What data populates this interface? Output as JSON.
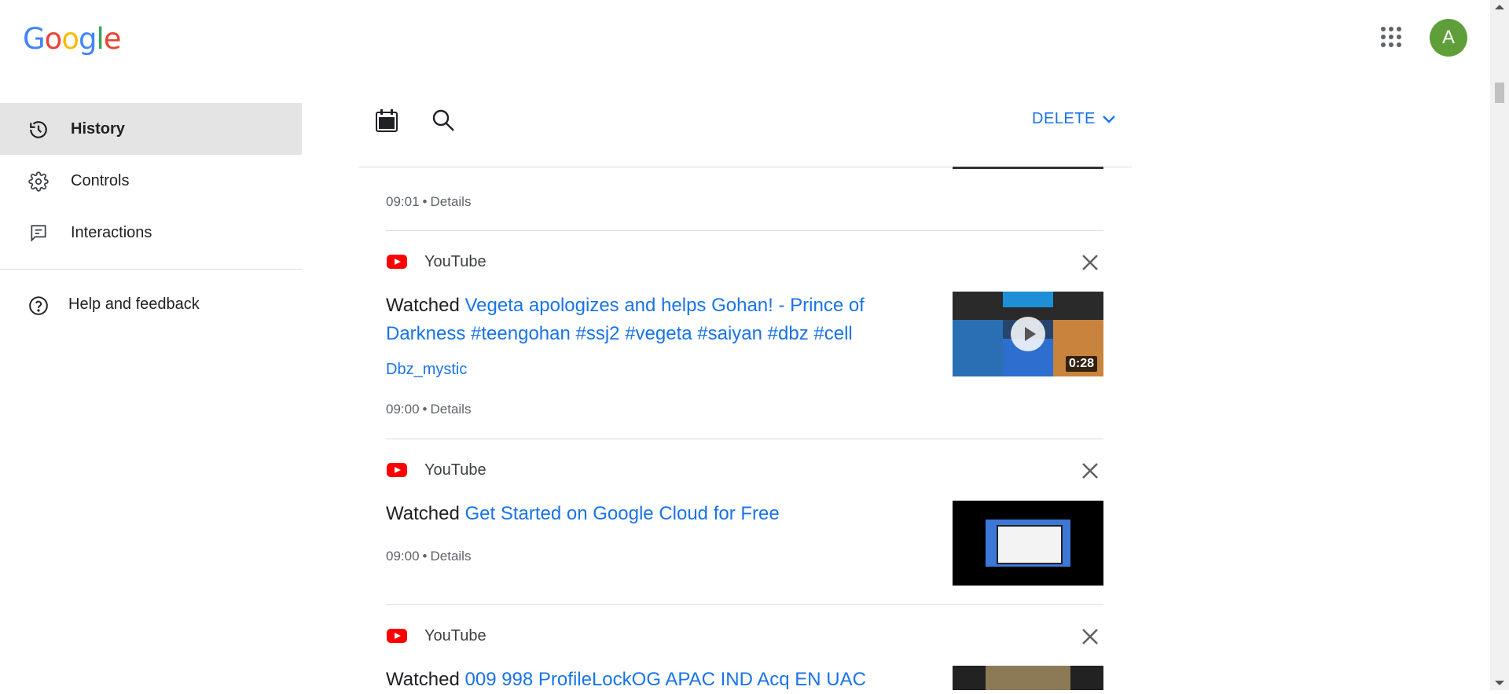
{
  "brand": {
    "letters": [
      {
        "ch": "G",
        "color": "#4285F4"
      },
      {
        "ch": "o",
        "color": "#EA4335"
      },
      {
        "ch": "o",
        "color": "#FBBC05"
      },
      {
        "ch": "g",
        "color": "#4285F4"
      },
      {
        "ch": "l",
        "color": "#34A853"
      },
      {
        "ch": "e",
        "color": "#EA4335"
      }
    ]
  },
  "account": {
    "avatar_letter": "A",
    "avatar_color": "#5f9f3a"
  },
  "nav": {
    "items": [
      {
        "label": "History",
        "icon": "history-icon",
        "active": true
      },
      {
        "label": "Controls",
        "icon": "gear-icon",
        "active": false
      },
      {
        "label": "Interactions",
        "icon": "feedback-icon",
        "active": false
      }
    ],
    "help": {
      "label": "Help and feedback",
      "icon": "help-icon"
    }
  },
  "toolbar": {
    "delete_label": "DELETE",
    "calendar_icon": "calendar-icon",
    "search_icon": "search-icon"
  },
  "top_partial": {
    "time": "09:01",
    "details": "Details"
  },
  "items": [
    {
      "source": "YouTube",
      "prefix": "Watched",
      "title": "Vegeta apologizes and helps Gohan! - Prince of Darkness #teengohan #ssj2 #vegeta #saiyan #dbz #cell",
      "channel": "Dbz_mystic",
      "time": "09:00",
      "details": "Details",
      "duration": "0:28"
    },
    {
      "source": "YouTube",
      "prefix": "Watched",
      "title": "Get Started on Google Cloud for Free",
      "time": "09:00",
      "details": "Details"
    },
    {
      "source": "YouTube",
      "prefix": "Watched",
      "title": "009 998 ProfileLockOG APAC IND Acq EN UAC"
    }
  ],
  "colors": {
    "accent": "#1a73e8",
    "youtube_red": "#ff0000"
  }
}
